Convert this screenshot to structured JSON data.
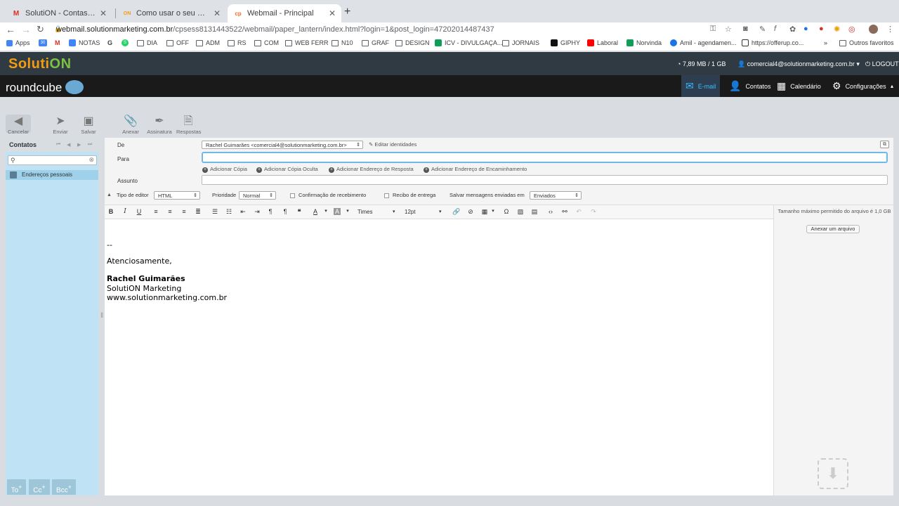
{
  "browser": {
    "tabs": [
      {
        "title": "SolutiON - Contas de email co",
        "favicon": "M"
      },
      {
        "title": "Como usar o seu Webmail - So",
        "favicon": "ON"
      },
      {
        "title": "Webmail - Principal",
        "favicon": "cp"
      }
    ],
    "new_tab": "+",
    "url_host": "webmail.solutionmarketing.com.br",
    "url_path": "/cpsess8131443522/webmail/paper_lantern/index.html?login=1&post_login=47202014487437",
    "bookmarks": [
      "Apps",
      "30",
      "M",
      "NOTAS",
      "G",
      "S",
      "DIA",
      "OFF",
      "ADM",
      "RS",
      "COM",
      "WEB FERR",
      "N10",
      "GRAF",
      "DESIGN",
      "ICV - DIVULGAÇA...",
      "JORNAIS",
      "GIPHY",
      "Laboral",
      "Norvinda",
      "Amil - agendamen...",
      "https://offerup.co...",
      "»",
      "Outros favoritos"
    ],
    "colors": {
      "tab_bar": "#dee1e6",
      "active_tab": "#ffffff"
    }
  },
  "app": {
    "logo": "Soluti",
    "logo_end": "ON",
    "quota": "7,89 MB / 1 GB",
    "user": "comercial4@solutionmarketing.com.br",
    "logout": "LOGOUT",
    "brand": "roundcube",
    "tasks": {
      "email": "E-mail",
      "contacts": "Contatos",
      "calendar": "Calendário",
      "settings": "Configurações"
    },
    "colors": {
      "header": "#2f3a43",
      "taskbar": "#1a1a1a",
      "accent": "#37beff",
      "left_panel": "#bfe3f4"
    }
  },
  "toolbar": {
    "cancel": "Cancelar",
    "send": "Enviar",
    "save": "Salvar",
    "attach": "Anexar",
    "signature": "Assinatura",
    "responses": "Respostas"
  },
  "contacts": {
    "title": "Contatos",
    "search_placeholder": "",
    "address_book": "Endereços pessoais",
    "recipients": [
      "To",
      "Cc",
      "Bcc"
    ]
  },
  "compose": {
    "from_label": "De",
    "from_value": "Rachel Guimarães <comercial4@solutionmarketing.com.br>",
    "edit_identities": "Editar identidades",
    "to_label": "Para",
    "to_value": "",
    "add_cc": "Adicionar Cópia",
    "add_bcc": "Adicionar Cópia Oculta",
    "add_reply_to": "Adicionar Endereço de Resposta",
    "add_followup": "Adicionar Endereço de Encaminhamento",
    "subject_label": "Assunto",
    "subject_value": "",
    "editor_type_label": "Tipo de editor",
    "editor_type_value": "HTML",
    "priority_label": "Prioridade",
    "priority_value": "Normal",
    "read_receipt": "Confirmação de recebimento",
    "delivery_receipt": "Recibo de entrega",
    "save_sent_label": "Salvar mensagens enviadas em",
    "save_sent_value": "Enviados"
  },
  "editor": {
    "font_family": "Times",
    "font_size": "12pt",
    "body": {
      "sep": "--",
      "greeting": "Atenciosamente,",
      "name": "Rachel Guimarães",
      "company": "SolutiON Marketing",
      "site": "www.solutionmarketing.com.br"
    }
  },
  "attachments": {
    "max_size": "Tamanho máximo permitido do arquivo é 1,0 GB",
    "attach_file": "Anexar um arquivo"
  }
}
